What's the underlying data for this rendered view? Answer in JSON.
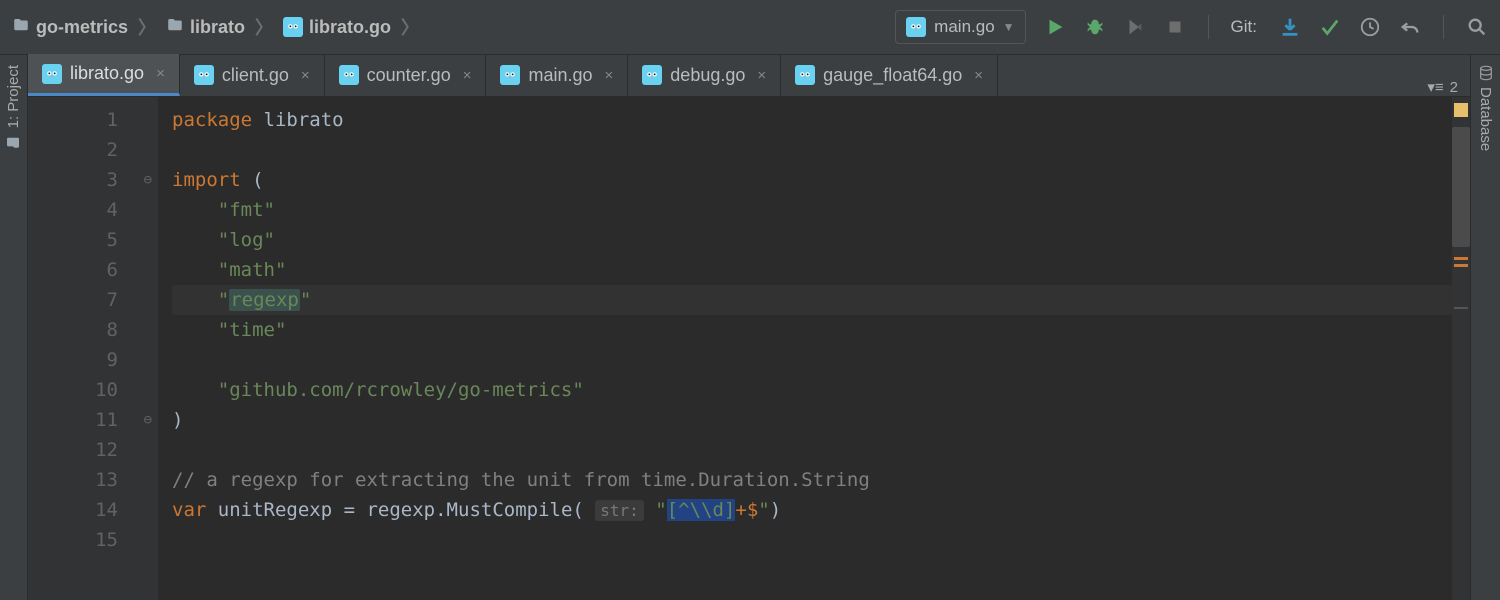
{
  "breadcrumb": {
    "seg1": "go-metrics",
    "seg2": "librato",
    "seg3": "librato.go"
  },
  "run_config": {
    "label": "main.go"
  },
  "git": {
    "label": "Git:"
  },
  "left_panel": {
    "label": "1: Project"
  },
  "right_panel": {
    "label": "Database"
  },
  "tabs": {
    "t0": {
      "label": "librato.go"
    },
    "t1": {
      "label": "client.go"
    },
    "t2": {
      "label": "counter.go"
    },
    "t3": {
      "label": "main.go"
    },
    "t4": {
      "label": "debug.go"
    },
    "t5": {
      "label": "gauge_float64.go"
    },
    "count": "2"
  },
  "lines": {
    "l1": "1",
    "l2": "2",
    "l3": "3",
    "l4": "4",
    "l5": "5",
    "l6": "6",
    "l7": "7",
    "l8": "8",
    "l9": "9",
    "l10": "10",
    "l11": "11",
    "l12": "12",
    "l13": "13",
    "l14": "14",
    "l15": "15"
  },
  "code": {
    "kw_package": "package",
    "pkg_name": "librato",
    "kw_import": "import",
    "paren_open": "(",
    "paren_close": ")",
    "imp_fmt": "\"fmt\"",
    "imp_log": "\"log\"",
    "imp_math": "\"math\"",
    "imp_regexp_q1": "\"",
    "imp_regexp_name": "regexp",
    "imp_regexp_q2": "\"",
    "imp_time": "\"time\"",
    "imp_metrics": "\"github.com/rcrowley/go-metrics\"",
    "comment": "// a regexp for extracting the unit from time.Duration.String",
    "kw_var": "var",
    "var_decl": "unitRegexp = regexp.MustCompile(",
    "hint": "str:",
    "regex_q1": "\"",
    "regex_body": "[^\\\\d]",
    "regex_plus": "+",
    "regex_dollar": "$",
    "regex_q2": "\"",
    "call_close": ")"
  }
}
